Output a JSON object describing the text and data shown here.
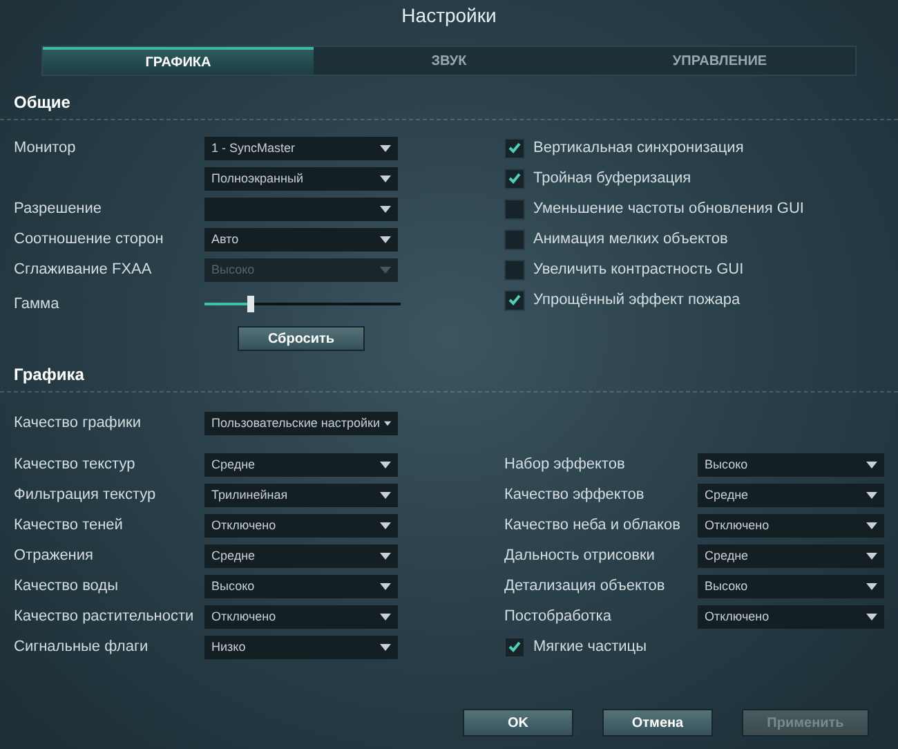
{
  "window": {
    "title": "Настройки"
  },
  "tabs": [
    {
      "label": "ГРАФИКА",
      "selected": true
    },
    {
      "label": "ЗВУК",
      "selected": false
    },
    {
      "label": "УПРАВЛЕНИЕ",
      "selected": false
    }
  ],
  "general": {
    "heading": "Общие",
    "left": [
      {
        "kind": "dropdown",
        "label": "Монитор",
        "value": "1 - SyncMaster",
        "disabled": false
      },
      {
        "kind": "dropdown",
        "value": "Полноэкранный",
        "disabled": false
      },
      {
        "kind": "dropdown",
        "label": "Разрешение",
        "disabled": false
      },
      {
        "kind": "dropdown",
        "label": "Соотношение сторон",
        "value": "Авто",
        "disabled": false
      },
      {
        "kind": "dropdown",
        "label": "Сглаживание FXAA",
        "value": "Высоко",
        "disabled": true
      },
      {
        "kind": "slider",
        "label": "Гамма",
        "level": 0.23
      },
      {
        "kind": "button",
        "value": "Сбросить"
      }
    ],
    "checkboxes": [
      {
        "label": "Вертикальная синхронизация",
        "checked": true
      },
      {
        "label": "Тройная буферизация",
        "checked": true
      },
      {
        "label": "Уменьшение частоты обновления GUI",
        "checked": false
      },
      {
        "label": "Анимация мелких объектов",
        "checked": false
      },
      {
        "label": "Увеличить контрастность GUI",
        "checked": false
      },
      {
        "label": "Упрощённый эффект пожара",
        "checked": true
      }
    ]
  },
  "graphics": {
    "heading": "Графика",
    "preset": {
      "label": "Качество графики",
      "value": "Пользовательские настройки"
    },
    "left": [
      {
        "kind": "dropdown",
        "label": "Качество текстур",
        "value": "Средне"
      },
      {
        "kind": "dropdown",
        "label": "Фильтрация текстур",
        "value": "Трилинейная"
      },
      {
        "kind": "dropdown",
        "label": "Качество теней",
        "value": "Отключено"
      },
      {
        "kind": "dropdown",
        "label": "Отражения",
        "value": "Средне"
      },
      {
        "kind": "dropdown",
        "label": "Качество воды",
        "value": "Высоко"
      },
      {
        "kind": "dropdown",
        "label": "Качество растительности",
        "value": "Отключено"
      },
      {
        "kind": "dropdown",
        "label": "Сигнальные флаги",
        "value": "Низко"
      }
    ],
    "right": [
      {
        "kind": "dropdown",
        "label": "Набор эффектов",
        "value": "Высоко"
      },
      {
        "kind": "dropdown",
        "label": "Качество эффектов",
        "value": "Средне"
      },
      {
        "kind": "dropdown",
        "label": "Качество неба и облаков",
        "value": "Отключено"
      },
      {
        "kind": "dropdown",
        "label": "Дальность отрисовки",
        "value": "Средне"
      },
      {
        "kind": "dropdown",
        "label": "Детализация объектов",
        "value": "Высоко"
      },
      {
        "kind": "dropdown",
        "label": "Постобработка",
        "value": "Отключено"
      },
      {
        "kind": "checkbox",
        "label": "Мягкие частицы",
        "checked": true
      }
    ]
  },
  "buttons": [
    {
      "label": "OK",
      "disabled": false
    },
    {
      "label": "Отмена",
      "disabled": false
    },
    {
      "label": "Применить",
      "disabled": true
    }
  ]
}
